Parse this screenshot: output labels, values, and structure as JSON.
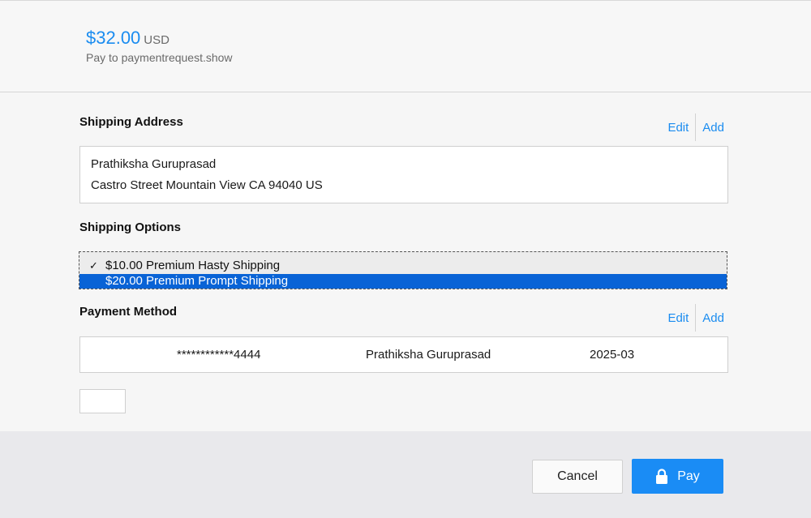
{
  "total": {
    "amount": "$32.00",
    "currency": "USD"
  },
  "payee": "Pay to paymentrequest.show",
  "shipping_address": {
    "title": "Shipping Address",
    "edit_label": "Edit",
    "add_label": "Add",
    "name": "Prathiksha Guruprasad",
    "address": "Castro Street Mountain View CA 94040 US"
  },
  "shipping_options": {
    "title": "Shipping Options",
    "options": [
      {
        "label": "$10.00 Premium Hasty Shipping",
        "checked": true
      },
      {
        "label": "$20.00 Premium Prompt Shipping",
        "highlighted": true
      }
    ],
    "check_glyph": "✓"
  },
  "payment_method": {
    "title": "Payment Method",
    "edit_label": "Edit",
    "add_label": "Add",
    "card_number": "************4444",
    "cardholder": "Prathiksha Guruprasad",
    "expiry": "2025-03"
  },
  "buttons": {
    "cancel": "Cancel",
    "pay": "Pay",
    "pay_icon": "lock-icon"
  },
  "colors": {
    "accent": "#1a8cf0",
    "selection": "#0963d6"
  }
}
